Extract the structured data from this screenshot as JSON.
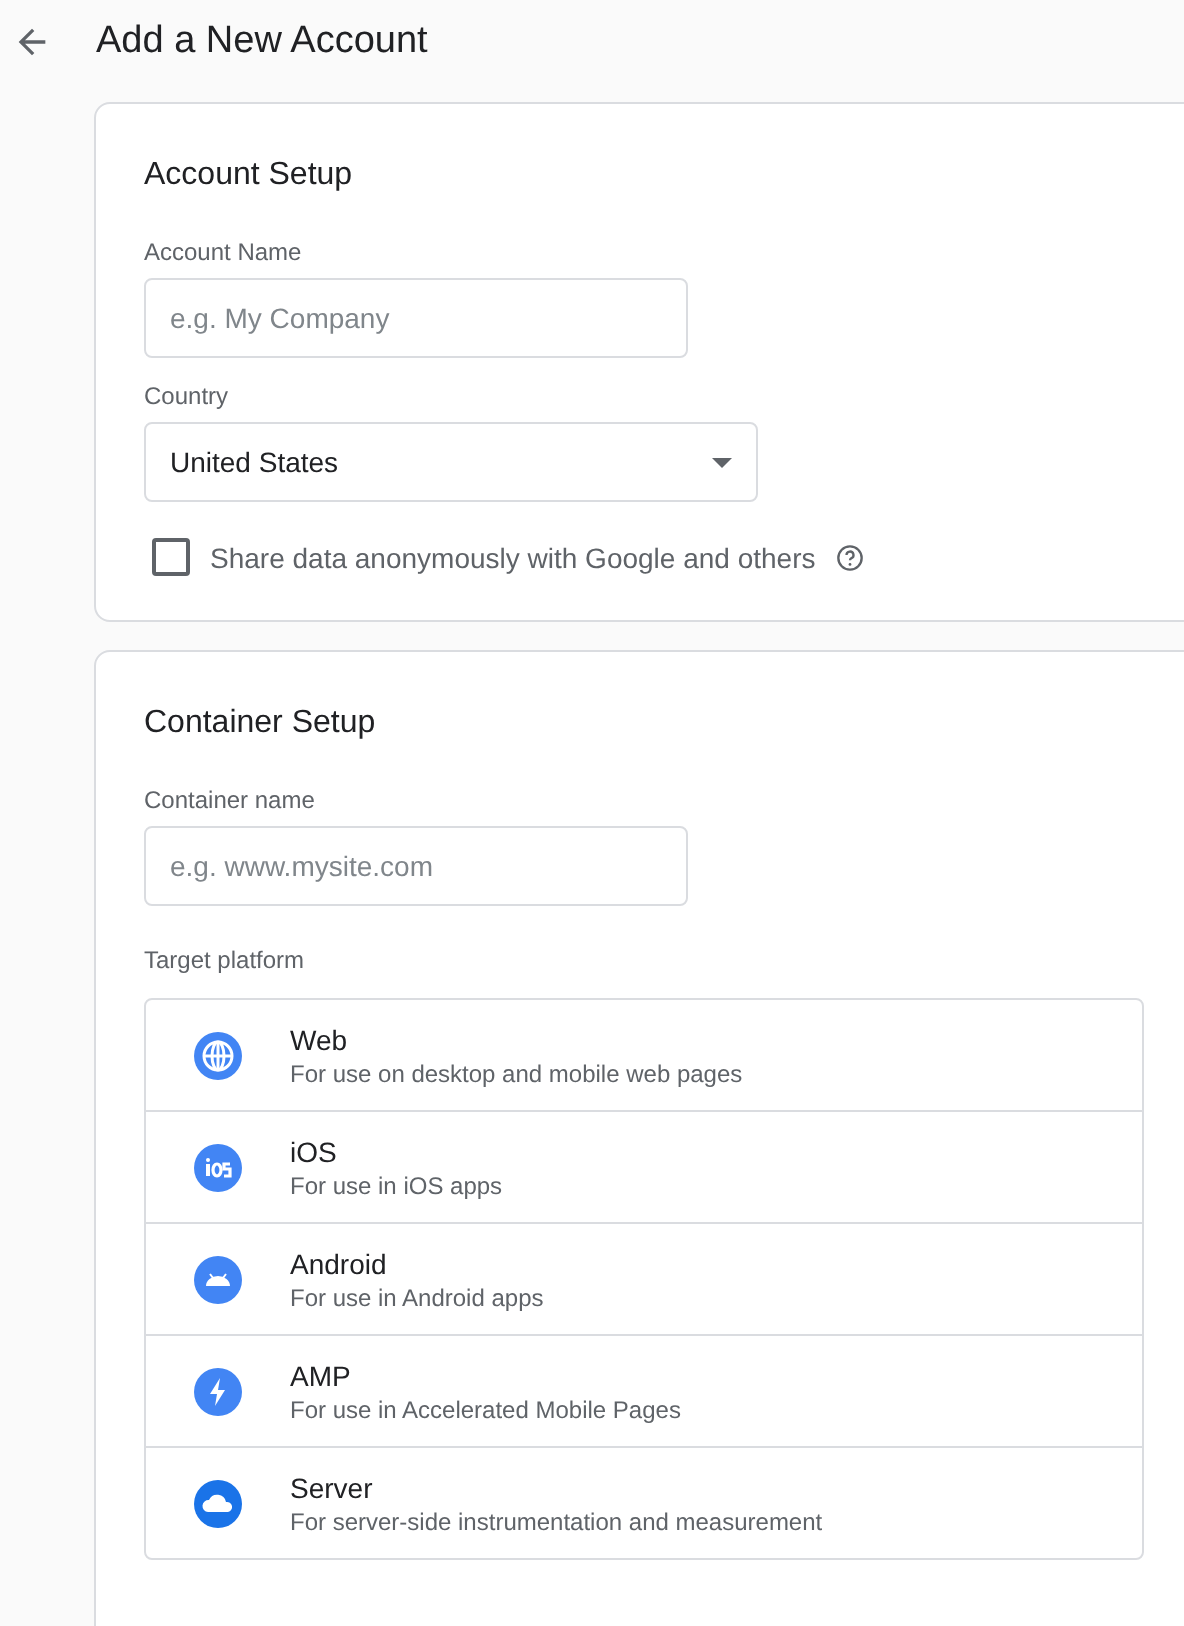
{
  "header": {
    "title": "Add a New Account"
  },
  "account_setup": {
    "title": "Account Setup",
    "account_name": {
      "label": "Account Name",
      "placeholder": "e.g. My Company"
    },
    "country": {
      "label": "Country",
      "value": "United States"
    },
    "share_data": {
      "label": "Share data anonymously with Google and others",
      "checked": false
    }
  },
  "container_setup": {
    "title": "Container Setup",
    "container_name": {
      "label": "Container name",
      "placeholder": "e.g. www.mysite.com"
    },
    "target_platform": {
      "label": "Target platform",
      "platforms": [
        {
          "kind": "web",
          "name": "Web",
          "description": "For use on desktop and mobile web pages"
        },
        {
          "kind": "ios",
          "name": "iOS",
          "description": "For use in iOS apps"
        },
        {
          "kind": "android",
          "name": "Android",
          "description": "For use in Android apps"
        },
        {
          "kind": "amp",
          "name": "AMP",
          "description": "For use in Accelerated Mobile Pages"
        },
        {
          "kind": "server",
          "name": "Server",
          "description": "For server-side instrumentation and measurement"
        }
      ]
    }
  }
}
